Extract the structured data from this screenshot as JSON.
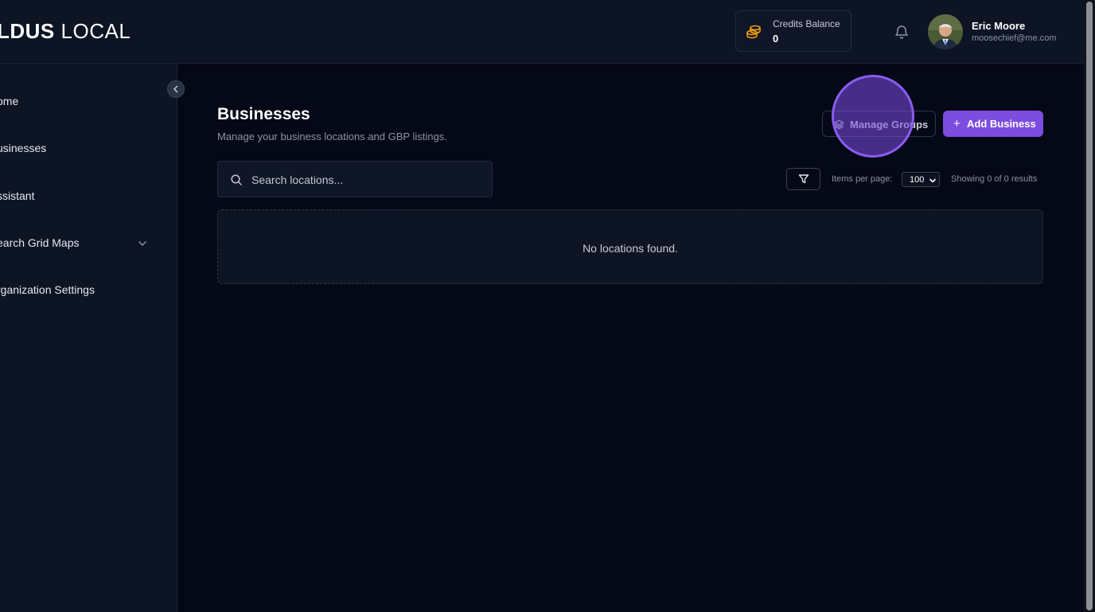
{
  "header": {
    "brand_bold": "LDUS",
    "brand_light": "LOCAL",
    "credits_label": "Credits Balance",
    "credits_value": "0",
    "user_name": "Eric Moore",
    "user_email": "moosechief@me.com"
  },
  "sidebar": {
    "items": [
      {
        "label": "ome"
      },
      {
        "label": "usinesses"
      },
      {
        "label": "ssistant"
      },
      {
        "label": "earch Grid Maps"
      },
      {
        "label": "rganization Settings"
      }
    ]
  },
  "main": {
    "title": "Businesses",
    "subtitle": "Manage your business locations and GBP listings.",
    "manage_groups_label": "Manage Groups",
    "add_business_label": "Add Business",
    "search_placeholder": "Search locations...",
    "items_per_page_label": "Items per page:",
    "items_per_page_value": "100",
    "showing_text": "Showing 0 of 0 results",
    "empty_message": "No locations found."
  },
  "colors": {
    "accent": "#7c4ddf",
    "background": "#050816",
    "panel": "#0d1424",
    "coin": "#f59e0b"
  },
  "icons": [
    "coins-icon",
    "bell-icon",
    "chevron-left-icon",
    "chevron-down-icon",
    "layers-icon",
    "plus-icon",
    "search-icon",
    "filter-icon"
  ]
}
